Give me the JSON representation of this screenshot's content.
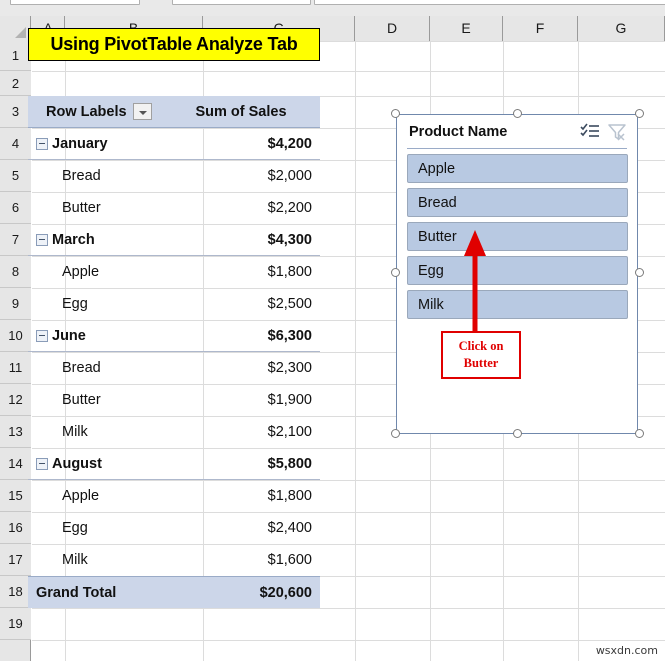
{
  "app": {
    "watermark": "wsxdn.com"
  },
  "grid": {
    "column_headers": [
      "A",
      "B",
      "C",
      "D",
      "E",
      "F",
      "G"
    ],
    "row_headers": [
      "1",
      "2",
      "3",
      "4",
      "5",
      "6",
      "7",
      "8",
      "9",
      "10",
      "11",
      "12",
      "13",
      "14",
      "15",
      "16",
      "17",
      "18",
      "19"
    ]
  },
  "title": {
    "text": "Using PivotTable Analyze Tab",
    "background": "#ffff00",
    "border": "#000000"
  },
  "pivot": {
    "header": {
      "row_labels": "Row Labels",
      "values": "Sum of Sales",
      "filter_icon": "filter-dropdown-icon",
      "background": "#ccd6e9"
    },
    "rows": [
      {
        "label": "January",
        "value": "$4,200",
        "type": "group",
        "collapse_icon": "collapse-minus-icon"
      },
      {
        "label": "Bread",
        "value": "$2,000",
        "type": "item"
      },
      {
        "label": "Butter",
        "value": "$2,200",
        "type": "item"
      },
      {
        "label": "March",
        "value": "$4,300",
        "type": "group",
        "collapse_icon": "collapse-minus-icon"
      },
      {
        "label": "Apple",
        "value": "$1,800",
        "type": "item"
      },
      {
        "label": "Egg",
        "value": "$2,500",
        "type": "item"
      },
      {
        "label": "June",
        "value": "$6,300",
        "type": "group",
        "collapse_icon": "collapse-minus-icon"
      },
      {
        "label": "Bread",
        "value": "$2,300",
        "type": "item"
      },
      {
        "label": "Butter",
        "value": "$1,900",
        "type": "item"
      },
      {
        "label": "Milk",
        "value": "$2,100",
        "type": "item"
      },
      {
        "label": "August",
        "value": "$5,800",
        "type": "group",
        "collapse_icon": "collapse-minus-icon"
      },
      {
        "label": "Apple",
        "value": "$1,800",
        "type": "item"
      },
      {
        "label": "Egg",
        "value": "$2,400",
        "type": "item"
      },
      {
        "label": "Milk",
        "value": "$1,600",
        "type": "item"
      }
    ],
    "grand_total": {
      "label": "Grand Total",
      "value": "$20,600"
    }
  },
  "slicer": {
    "title": "Product Name",
    "multi_select_icon": "multi-select-checklist-icon",
    "clear_filter_icon": "clear-filter-funnel-icon",
    "item_background": "#b8c9e2",
    "items": [
      {
        "label": "Apple"
      },
      {
        "label": "Bread"
      },
      {
        "label": "Butter"
      },
      {
        "label": "Egg"
      },
      {
        "label": "Milk"
      }
    ]
  },
  "annotation": {
    "callout_line_1": "Click on",
    "callout_line_2": "Butter",
    "color": "#e00000",
    "arrow_icon": "up-arrow-icon"
  }
}
